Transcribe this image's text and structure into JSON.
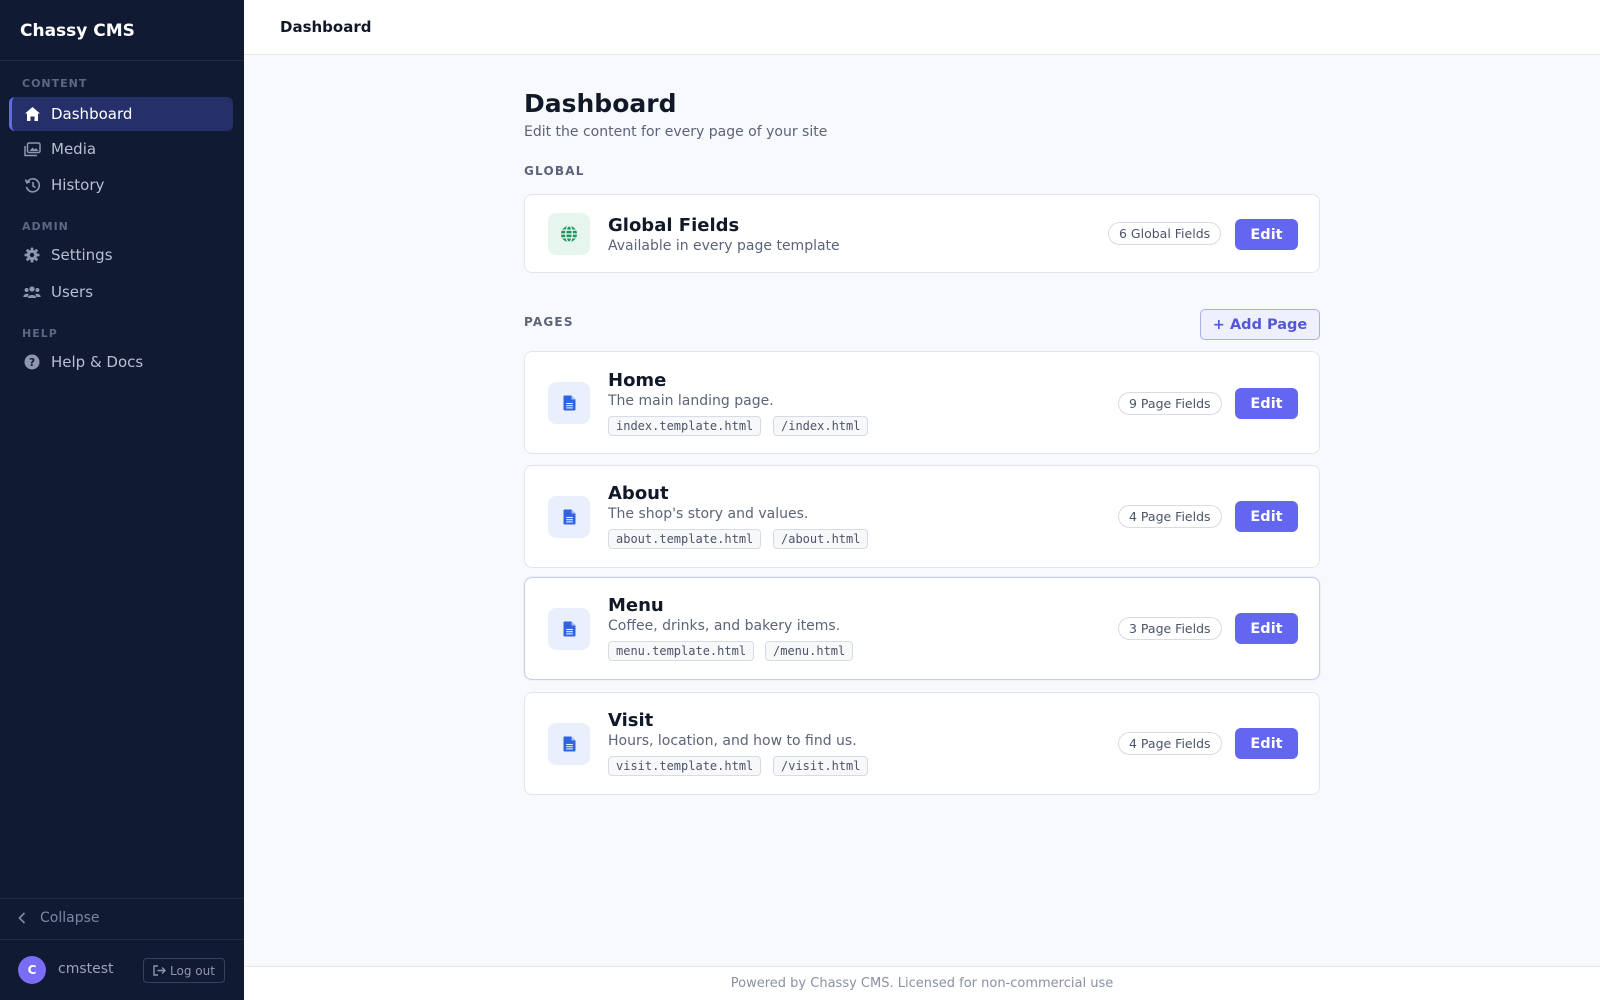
{
  "app": {
    "name": "Chassy CMS"
  },
  "sidebar": {
    "sections": {
      "content": "CONTENT",
      "admin": "ADMIN",
      "help": "HELP"
    },
    "items": {
      "dashboard": {
        "label": "Dashboard",
        "icon": "home-icon",
        "active": true
      },
      "media": {
        "label": "Media",
        "icon": "images-icon"
      },
      "history": {
        "label": "History",
        "icon": "history-icon"
      },
      "settings": {
        "label": "Settings",
        "icon": "gear-icon"
      },
      "users": {
        "label": "Users",
        "icon": "users-icon"
      },
      "help": {
        "label": "Help & Docs",
        "icon": "question-circle-icon"
      }
    },
    "collapse_label": "Collapse",
    "user": {
      "initial": "C",
      "name": "cmstest"
    },
    "logout_label": "Log out"
  },
  "topbar": {
    "title": "Dashboard"
  },
  "main": {
    "title": "Dashboard",
    "subtitle": "Edit the content for every page of your site",
    "global_label": "GLOBAL",
    "global_card": {
      "title": "Global Fields",
      "description": "Available in every page template",
      "count": "6 Global Fields",
      "edit_label": "Edit",
      "icon": "globe-icon"
    },
    "pages_label": "PAGES",
    "add_page_label": "+ Add Page",
    "pages": [
      {
        "title": "Home",
        "description": "The main landing page.",
        "template": "index.template.html",
        "path": "/index.html",
        "count": "9 Page Fields",
        "edit_label": "Edit"
      },
      {
        "title": "About",
        "description": "The shop's story and values.",
        "template": "about.template.html",
        "path": "/about.html",
        "count": "4 Page Fields",
        "edit_label": "Edit"
      },
      {
        "title": "Menu",
        "description": "Coffee, drinks, and bakery items.",
        "template": "menu.template.html",
        "path": "/menu.html",
        "count": "3 Page Fields",
        "edit_label": "Edit"
      },
      {
        "title": "Visit",
        "description": "Hours, location, and how to find us.",
        "template": "visit.template.html",
        "path": "/visit.html",
        "count": "4 Page Fields",
        "edit_label": "Edit"
      }
    ]
  },
  "footer": {
    "text": "Powered by Chassy CMS. Licensed for non-commercial use"
  },
  "colors": {
    "sidebar_bg": "#111a33",
    "accent": "#6366f1",
    "active_bg": "#25306a"
  }
}
